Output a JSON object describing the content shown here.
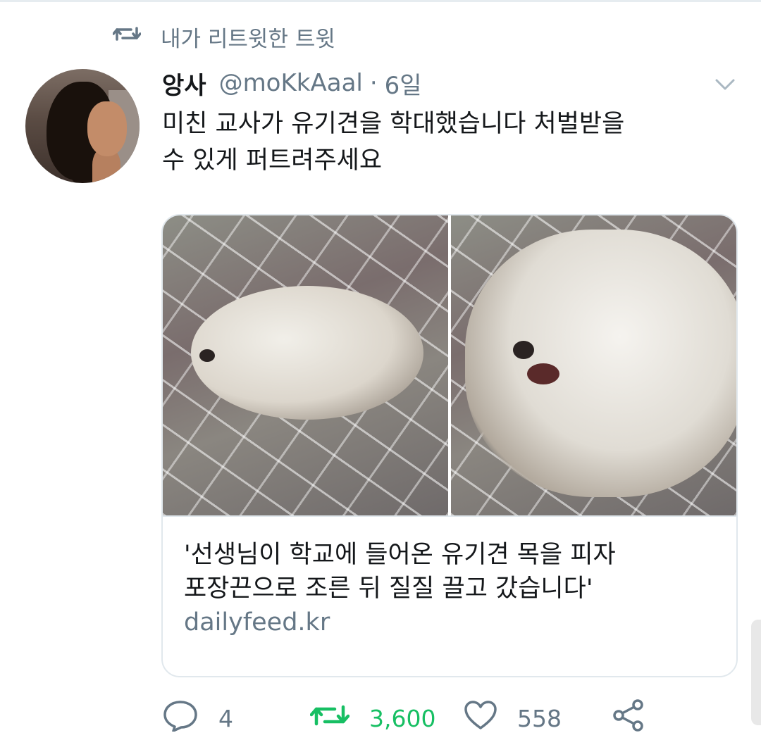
{
  "retweet_header": {
    "label": "내가 리트윗한 트윗"
  },
  "tweet": {
    "author_name": "앙사",
    "handle": "@moKkAaal",
    "separator": "·",
    "time": "6일",
    "text_line1": "미친 교사가 유기견을 학대했습니다 처벌받을",
    "text_line2": "수 있게 퍼트려주세요"
  },
  "card": {
    "title_line1": "'선생님이 학교에 들어온 유기견 목을 피자",
    "title_line2": "포장끈으로 조른 뒤 질질 끌고 갔습니다'",
    "domain": "dailyfeed.kr"
  },
  "actions": {
    "reply_count": "4",
    "retweet_count": "3,600",
    "like_count": "558"
  },
  "colors": {
    "text": "#14171a",
    "muted": "#657786",
    "retweet_active": "#17bf63",
    "border": "#e1e8ed"
  },
  "icons": [
    "retweet-icon",
    "chevron-down-icon",
    "reply-icon",
    "like-icon",
    "share-icon"
  ]
}
